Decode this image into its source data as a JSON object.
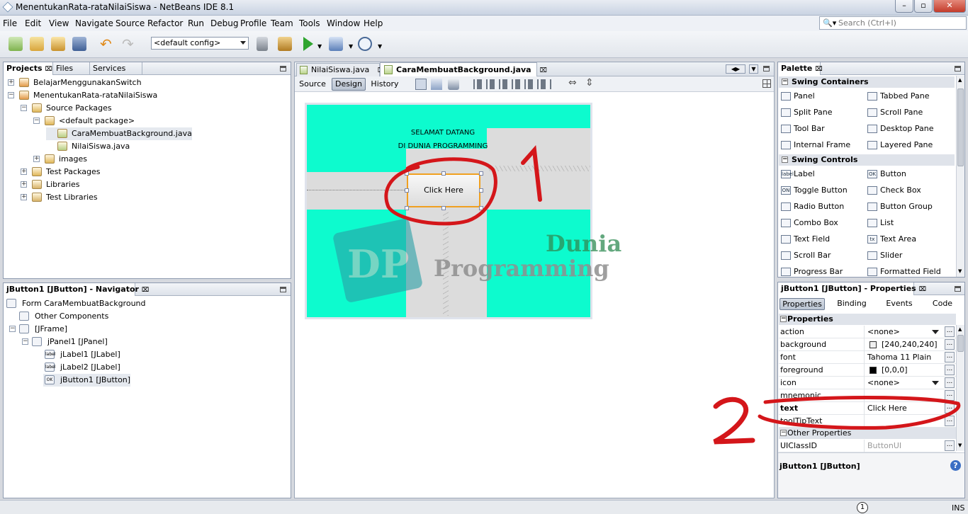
{
  "window": {
    "title": "MenentukanRata-rataNilaiSiswa - NetBeans IDE 8.1"
  },
  "menu": [
    "File",
    "Edit",
    "View",
    "Navigate",
    "Source",
    "Refactor",
    "Run",
    "Debug",
    "Profile",
    "Team",
    "Tools",
    "Window",
    "Help"
  ],
  "search": {
    "placeholder": "Search (Ctrl+I)"
  },
  "toolbar": {
    "config": "<default config>"
  },
  "projects_panel": {
    "tabs": [
      "Projects",
      "Files",
      "Services"
    ],
    "tree": [
      {
        "label": "BelajarMenggunakanSwitch",
        "level": 0,
        "exp": "+"
      },
      {
        "label": "MenentukanRata-rataNilaiSiswa",
        "level": 0,
        "exp": "−"
      },
      {
        "label": "Source Packages",
        "level": 1,
        "exp": "−"
      },
      {
        "label": "<default package>",
        "level": 2,
        "exp": "−"
      },
      {
        "label": "CaraMembuatBackground.java",
        "level": 3,
        "exp": ""
      },
      {
        "label": "NilaiSiswa.java",
        "level": 3,
        "exp": ""
      },
      {
        "label": "images",
        "level": 2,
        "exp": "+"
      },
      {
        "label": "Test Packages",
        "level": 1,
        "exp": "+"
      },
      {
        "label": "Libraries",
        "level": 1,
        "exp": "+"
      },
      {
        "label": "Test Libraries",
        "level": 1,
        "exp": "+"
      }
    ]
  },
  "navigator": {
    "title": "jButton1 [JButton] - Navigator",
    "tree": [
      {
        "label": "Form CaraMembuatBackground",
        "level": 0
      },
      {
        "label": "Other Components",
        "level": 1
      },
      {
        "label": "[JFrame]",
        "level": 1
      },
      {
        "label": "jPanel1 [JPanel]",
        "level": 2
      },
      {
        "label": "jLabel1 [JLabel]",
        "level": 3
      },
      {
        "label": "jLabel2 [JLabel]",
        "level": 3
      },
      {
        "label": "jButton1 [JButton]",
        "level": 3
      }
    ]
  },
  "editor": {
    "tabs": [
      "NilaiSiswa.java",
      "CaraMembuatBackground.java"
    ],
    "views": [
      "Source",
      "Design",
      "History"
    ],
    "form": {
      "label1": "SELAMAT DATANG",
      "label2": "DI DUNIA PROGRAMMING",
      "button": "Click Here",
      "panel_color": "#0dfbce"
    }
  },
  "palette": {
    "title": "Palette",
    "categories": [
      {
        "name": "Swing Containers",
        "items": [
          "Panel",
          "Tabbed Pane",
          "Split Pane",
          "Scroll Pane",
          "Tool Bar",
          "Desktop Pane",
          "Internal Frame",
          "Layered Pane"
        ]
      },
      {
        "name": "Swing Controls",
        "items": [
          "Label",
          "Button",
          "Toggle Button",
          "Check Box",
          "Radio Button",
          "Button Group",
          "Combo Box",
          "List",
          "Text Field",
          "Text Area",
          "Scroll Bar",
          "Slider",
          "Progress Bar",
          "Formatted Field"
        ]
      }
    ],
    "icon_text": {
      "Label": "label",
      "Button": "OK",
      "Toggle Button": "ON",
      "Text Area": "tx"
    }
  },
  "properties": {
    "title": "jButton1 [JButton] - Properties",
    "tabs": [
      "Properties",
      "Binding",
      "Events",
      "Code"
    ],
    "section": "Properties",
    "rows": [
      {
        "name": "action",
        "value": "<none>",
        "dropdown": true
      },
      {
        "name": "background",
        "value": "[240,240,240]",
        "swatch": "#f0f0f0"
      },
      {
        "name": "font",
        "value": "Tahoma 11 Plain"
      },
      {
        "name": "foreground",
        "value": "[0,0,0]",
        "swatch": "#000000"
      },
      {
        "name": "icon",
        "value": "<none>",
        "dropdown": true
      },
      {
        "name": "mnemonic",
        "value": ""
      },
      {
        "name": "text",
        "value": "Click Here",
        "bold": true
      },
      {
        "name": "toolTipText",
        "value": ""
      }
    ],
    "other_section": "Other Properties",
    "rows2": [
      {
        "name": "UIClassID",
        "value": "ButtonUI",
        "grey": true
      }
    ],
    "footer": "jButton1 [JButton]"
  },
  "statusbar": {
    "right": "INS",
    "notif": "1"
  },
  "annotations": {
    "mark1": "1",
    "mark2": "2",
    "watermark1": "Dunia",
    "watermark2": "Programming",
    "logo": "DP"
  }
}
